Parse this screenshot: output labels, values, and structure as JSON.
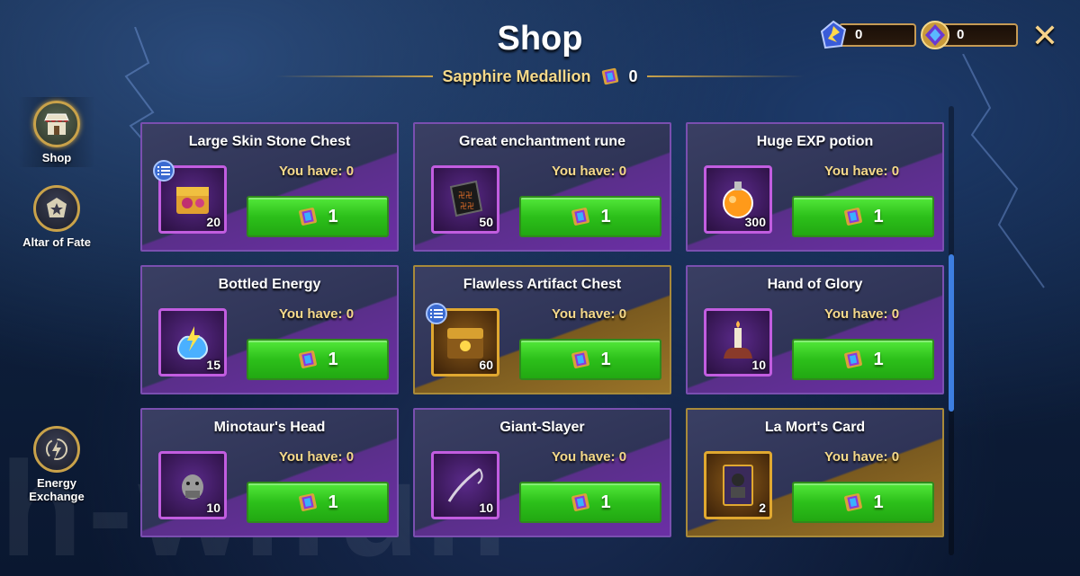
{
  "header": {
    "title": "Shop",
    "subtitle": "Sapphire Medallion",
    "medallion_count": "0"
  },
  "currencies": [
    {
      "icon": "energy-crystal-icon",
      "value": "0"
    },
    {
      "icon": "medal-icon",
      "value": "0"
    }
  ],
  "close_icon": "close-icon",
  "nav": [
    {
      "label": "Shop",
      "icon": "shop-icon",
      "active": true
    },
    {
      "label": "Altar of Fate",
      "icon": "star-icon",
      "active": false
    },
    {
      "label": "Energy Exchange",
      "icon": "lightning-icon",
      "active": false
    }
  ],
  "items": [
    {
      "name": "Large Skin Stone Chest",
      "you_have": "You have: 0",
      "qty": "20",
      "price": "1",
      "icon": "skin-stone-chest-icon",
      "rarity": "purple",
      "info": true
    },
    {
      "name": "Great enchantment rune",
      "you_have": "You have: 0",
      "qty": "50",
      "price": "1",
      "icon": "enchantment-rune-icon",
      "rarity": "purple",
      "info": false
    },
    {
      "name": "Huge EXP potion",
      "you_have": "You have: 0",
      "qty": "300",
      "price": "1",
      "icon": "exp-potion-icon",
      "rarity": "purple",
      "info": false
    },
    {
      "name": "Bottled Energy",
      "you_have": "You have: 0",
      "qty": "15",
      "price": "1",
      "icon": "bottled-energy-icon",
      "rarity": "purple",
      "info": false
    },
    {
      "name": "Flawless Artifact Chest",
      "you_have": "You have: 0",
      "qty": "60",
      "price": "1",
      "icon": "artifact-chest-icon",
      "rarity": "gold",
      "info": true
    },
    {
      "name": "Hand of Glory",
      "you_have": "You have: 0",
      "qty": "10",
      "price": "1",
      "icon": "hand-of-glory-icon",
      "rarity": "purple",
      "info": false
    },
    {
      "name": "Minotaur's Head",
      "you_have": "You have: 0",
      "qty": "10",
      "price": "1",
      "icon": "minotaur-head-icon",
      "rarity": "purple",
      "info": false
    },
    {
      "name": "Giant-Slayer",
      "you_have": "You have: 0",
      "qty": "10",
      "price": "1",
      "icon": "giant-slayer-icon",
      "rarity": "purple",
      "info": false
    },
    {
      "name": "La Mort's Card",
      "you_have": "You have: 0",
      "qty": "2",
      "price": "1",
      "icon": "la-morts-card-icon",
      "rarity": "gold",
      "info": false
    }
  ],
  "colors": {
    "buy_button": "#2cc01a",
    "purple_border": "#c25de0",
    "gold_border": "#e0a830",
    "label_gold": "#f5d98a"
  },
  "watermark": "h-w.fun"
}
